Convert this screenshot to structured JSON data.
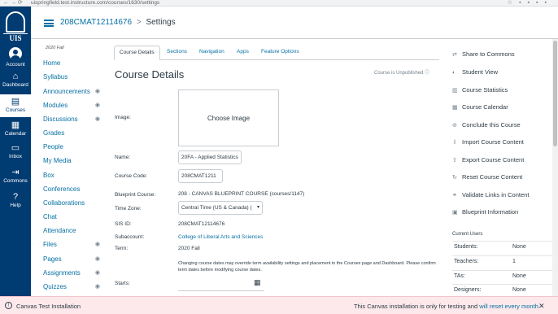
{
  "browser": {
    "url": "uispringfield.test.instructure.com/courses/1630/settings"
  },
  "global_nav": {
    "logo_text": "UIS",
    "items": [
      {
        "label": "Account"
      },
      {
        "label": "Dashboard"
      },
      {
        "label": "Courses"
      },
      {
        "label": "Calendar"
      },
      {
        "label": "Inbox"
      },
      {
        "label": "Commons"
      },
      {
        "label": "Help"
      }
    ]
  },
  "header": {
    "course": "208CMAT12114676",
    "separator": ">",
    "current": "Settings"
  },
  "course_nav": {
    "term": "2020 Fall",
    "items": [
      {
        "label": "Home"
      },
      {
        "label": "Syllabus"
      },
      {
        "label": "Announcements"
      },
      {
        "label": "Modules"
      },
      {
        "label": "Discussions"
      },
      {
        "label": "Grades"
      },
      {
        "label": "People"
      },
      {
        "label": "My Media"
      },
      {
        "label": "Box"
      },
      {
        "label": "Conferences"
      },
      {
        "label": "Collaborations"
      },
      {
        "label": "Chat"
      },
      {
        "label": "Attendance"
      },
      {
        "label": "Files"
      },
      {
        "label": "Pages"
      },
      {
        "label": "Assignments"
      },
      {
        "label": "Quizzes"
      }
    ]
  },
  "tabs": [
    {
      "label": "Course Details"
    },
    {
      "label": "Sections"
    },
    {
      "label": "Navigation"
    },
    {
      "label": "Apps"
    },
    {
      "label": "Feature Options"
    }
  ],
  "main": {
    "title": "Course Details",
    "publish_status": "Course is Unpublished",
    "image_label": "Image:",
    "choose_image": "Choose Image",
    "name_label": "Name:",
    "name_value": "20FA - Applied Statistics",
    "code_label": "Course Code:",
    "code_value": "208CMAT1211",
    "blueprint_label": "Blueprint Course:",
    "blueprint_value": "208 - CANVAS BLUEPRINT COURSE (courses/1147)",
    "timezone_label": "Time Zone:",
    "timezone_value": "Central Time (US & Canada) (",
    "sis_label": "SIS ID:",
    "sis_value": "208CMAT12114676",
    "subaccount_label": "Subaccount:",
    "subaccount_value": "College of Liberal Arts and Sciences",
    "term_label": "Term:",
    "term_value": "2020 Fall",
    "term_note": "Changing course dates may override term availability settings and placement in the Courses page and Dashboard. Please confirm term dates before modifying course dates.",
    "starts_label": "Starts:"
  },
  "sidebar": {
    "actions": [
      {
        "label": "Share to Commons",
        "icon": "share-icon"
      },
      {
        "label": "Student View",
        "icon": "student-view-icon"
      },
      {
        "label": "Course Statistics",
        "icon": "statistics-icon"
      },
      {
        "label": "Course Calendar",
        "icon": "calendar-icon"
      },
      {
        "label": "Conclude this Course",
        "icon": "conclude-icon"
      },
      {
        "label": "Import Course Content",
        "icon": "import-icon"
      },
      {
        "label": "Export Course Content",
        "icon": "export-icon"
      },
      {
        "label": "Reset Course Content",
        "icon": "reset-icon"
      },
      {
        "label": "Validate Links in Content",
        "icon": "link-icon"
      },
      {
        "label": "Blueprint Information",
        "icon": "blueprint-icon"
      }
    ],
    "current_users_title": "Current Users",
    "users": [
      {
        "role": "Students:",
        "count": "None"
      },
      {
        "role": "Teachers:",
        "count": "1"
      },
      {
        "role": "TAs:",
        "count": "None"
      },
      {
        "role": "Designers:",
        "count": "None"
      }
    ]
  },
  "footer": {
    "title": "Canvas Test Installation",
    "message": "This Canvas installation is only for testing and",
    "message_link": "will reset every month."
  },
  "colors": {
    "nav_bg": "#003b71",
    "link": "#0770a3",
    "banner_bg": "#fde9ec"
  }
}
